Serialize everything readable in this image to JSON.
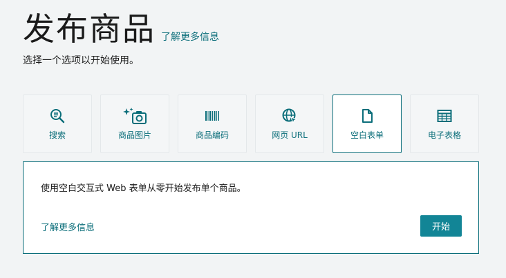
{
  "header": {
    "title": "发布商品",
    "learn_more": "了解更多信息",
    "subtitle": "选择一个选项以开始使用。"
  },
  "options": [
    {
      "label": "搜索",
      "icon": "search-list-icon",
      "selected": false
    },
    {
      "label": "商品图片",
      "icon": "camera-sparkle-icon",
      "selected": false
    },
    {
      "label": "商品编码",
      "icon": "barcode-icon",
      "selected": false
    },
    {
      "label": "网页 URL",
      "icon": "globe-cursor-icon",
      "selected": false
    },
    {
      "label": "空白表单",
      "icon": "document-icon",
      "selected": true
    },
    {
      "label": "电子表格",
      "icon": "spreadsheet-icon",
      "selected": false
    }
  ],
  "panel": {
    "description": "使用空白交互式 Web 表单从零开始发布单个商品。",
    "learn_more": "了解更多信息",
    "start_button": "开始"
  },
  "colors": {
    "accent": "#0b6e7a",
    "button": "#128596",
    "background": "#f2f4f5"
  }
}
